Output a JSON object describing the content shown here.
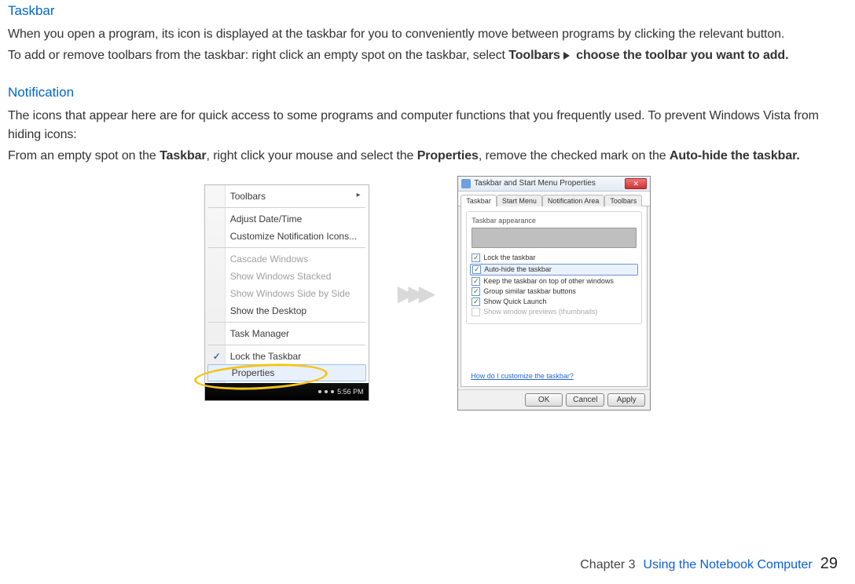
{
  "sections": {
    "taskbar": {
      "heading": "Taskbar",
      "p1": "When you open a program, its icon is displayed at the taskbar for you to conveniently move between programs by clicking the relevant button.",
      "p2_a": "To add or remove toolbars from the taskbar: right click an empty spot on the taskbar, select ",
      "p2_b_bold": "Toolbars",
      "p2_c_bold": " choose the toolbar you want to add."
    },
    "notification": {
      "heading": "Notification",
      "p1": "The icons that appear here are for quick access to some programs and computer functions that you frequently used. To prevent Windows Vista from hiding icons:",
      "p2_a": "From an empty spot on the ",
      "p2_b_bold": "Taskbar",
      "p2_c": ", right click your mouse and select the ",
      "p2_d_bold": "Properties",
      "p2_e": ", remove the checked mark on the ",
      "p2_f_bold": "Auto-hide the taskbar."
    }
  },
  "context_menu": {
    "items": {
      "toolbars": "Toolbars",
      "adjust": "Adjust Date/Time",
      "customize": "Customize Notification Icons...",
      "cascade": "Cascade Windows",
      "stacked": "Show Windows Stacked",
      "sidebyside": "Show Windows Side by Side",
      "desktop": "Show the Desktop",
      "taskmgr": "Task Manager",
      "lock": "Lock the Taskbar",
      "properties": "Properties"
    },
    "clock": "5:56 PM"
  },
  "dialog": {
    "title": "Taskbar and Start Menu Properties",
    "tabs": [
      "Taskbar",
      "Start Menu",
      "Notification Area",
      "Toolbars"
    ],
    "group": "Taskbar appearance",
    "options": {
      "lock": "Lock the taskbar",
      "autohide": "Auto-hide the taskbar",
      "ontop": "Keep the taskbar on top of other windows",
      "group_btn": "Group similar taskbar buttons",
      "quicklaunch": "Show Quick Launch",
      "previews": "Show window previews (thumbnails)"
    },
    "link": "How do I customize the taskbar?",
    "buttons": {
      "ok": "OK",
      "cancel": "Cancel",
      "apply": "Apply"
    }
  },
  "footer": {
    "chapter": "Chapter 3",
    "title": "Using the Notebook Computer",
    "page": "29"
  }
}
